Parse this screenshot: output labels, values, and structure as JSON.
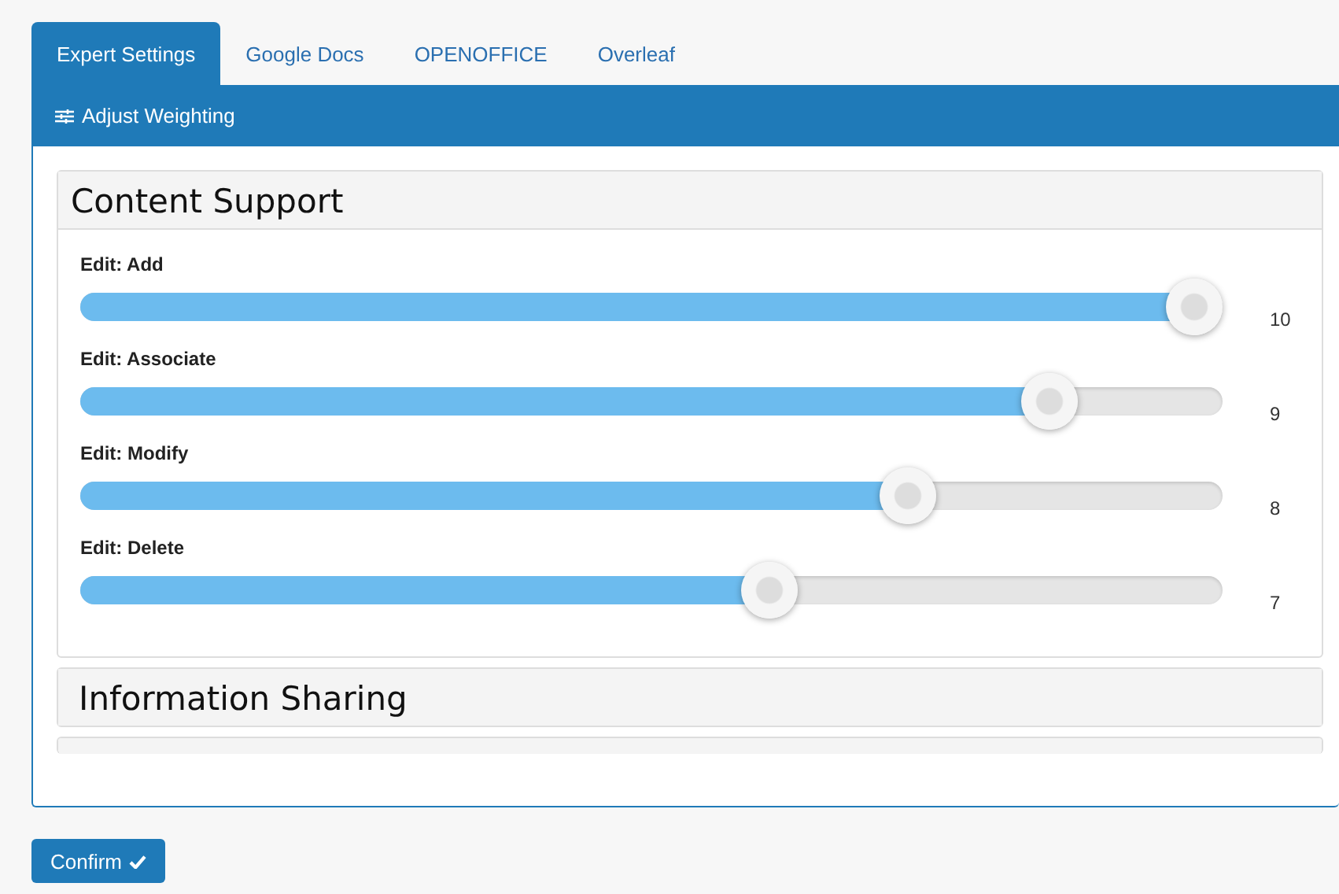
{
  "tabs": [
    {
      "label": "Expert Settings",
      "selected": true
    },
    {
      "label": "Google Docs",
      "selected": false
    },
    {
      "label": "OPENOFFICE",
      "selected": false
    },
    {
      "label": "Overleaf",
      "selected": false
    }
  ],
  "panel": {
    "title": "Adjust Weighting"
  },
  "sections": [
    {
      "title": "Content Support",
      "sliders": [
        {
          "label": "Edit: Add",
          "level": 1.0,
          "reading": "10"
        },
        {
          "label": "Edit: Associate",
          "level": 0.867,
          "reading": "9"
        },
        {
          "label": "Edit: Modify",
          "level": 0.736,
          "reading": "8"
        },
        {
          "label": "Edit: Delete",
          "level": 0.609,
          "reading": "7"
        }
      ]
    },
    {
      "title": "Information Sharing"
    }
  ],
  "confirm_button": {
    "label": "Confirm"
  }
}
